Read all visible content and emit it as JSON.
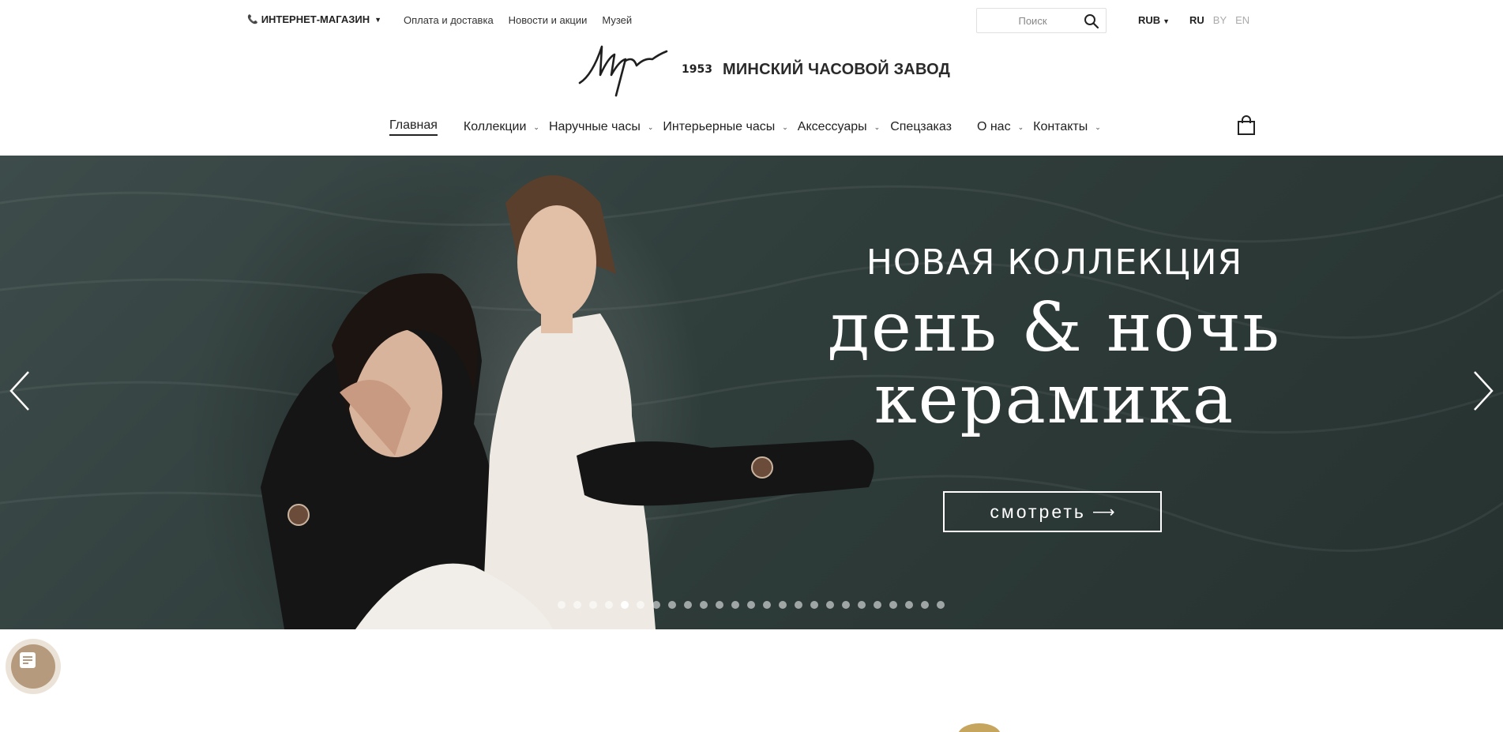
{
  "topbar": {
    "shop_label": "ИНТЕРНЕТ-МАГАЗИН",
    "links": [
      "Оплата и доставка",
      "Новости и акции",
      "Музей"
    ],
    "search_placeholder": "Поиск",
    "currency": "RUB",
    "languages": [
      {
        "label": "RU",
        "active": true
      },
      {
        "label": "BY",
        "active": false
      },
      {
        "label": "EN",
        "active": false
      }
    ]
  },
  "logo": {
    "year": "1953",
    "name": "МИНСКИЙ ЧАСОВОЙ ЗАВОД"
  },
  "nav": {
    "items": [
      {
        "label": "Главная",
        "dropdown": false,
        "active": true
      },
      {
        "label": "Коллекции",
        "dropdown": true,
        "active": false
      },
      {
        "label": "Наручные часы",
        "dropdown": true,
        "active": false
      },
      {
        "label": "Интерьерные часы",
        "dropdown": true,
        "active": false
      },
      {
        "label": "Аксессуары",
        "dropdown": true,
        "active": false
      },
      {
        "label": "Спецзаказ",
        "dropdown": false,
        "active": false
      },
      {
        "label": "О нас",
        "dropdown": true,
        "active": false
      },
      {
        "label": "Контакты",
        "dropdown": true,
        "active": false
      }
    ],
    "cart_icon": "shopping-bag-icon"
  },
  "hero": {
    "subtitle": "НОВАЯ КОЛЛЕКЦИЯ",
    "title_line1": "день & ночь",
    "title_line2": "керамика",
    "button_label": "смотреть",
    "button_arrow": "⟶",
    "slide_count": 25,
    "active_slide": 5
  },
  "colors": {
    "accent": "#222222",
    "hero_background": "#2f3d3b",
    "chat_button": "#b59a7d",
    "chat_ring": "#ece3d8",
    "gold": "#c6a55f"
  },
  "icons": {
    "phone": "phone-icon",
    "search": "search-icon",
    "prev": "chevron-left-icon",
    "next": "chevron-right-icon",
    "chat": "chat-icon"
  }
}
